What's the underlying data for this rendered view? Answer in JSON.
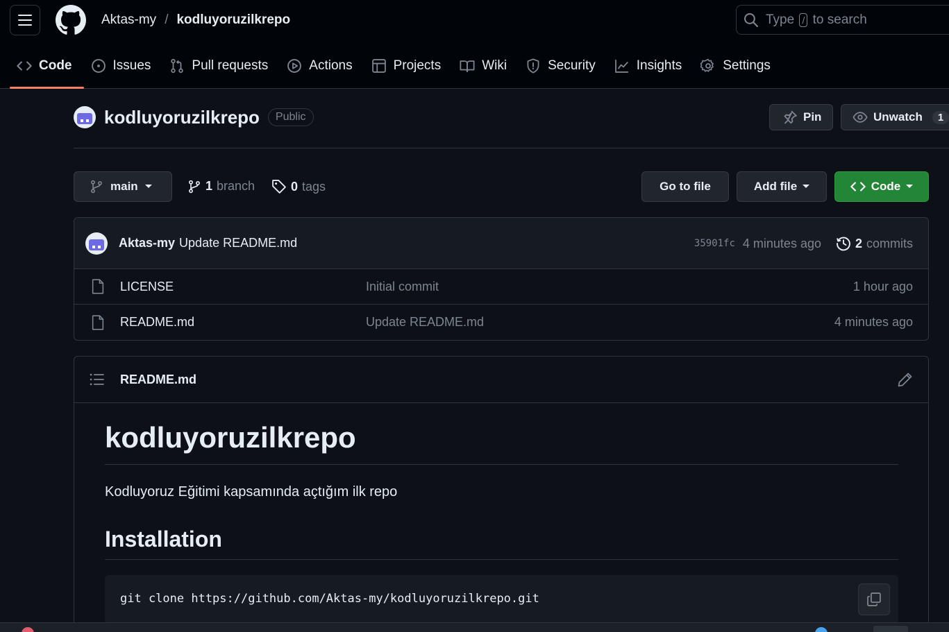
{
  "header": {
    "owner": "Aktas-my",
    "separator": "/",
    "repo": "kodluyoruzilkrepo",
    "search": {
      "before": "Type",
      "key": "/",
      "after": "to search"
    }
  },
  "tabs": [
    {
      "label": "Code",
      "icon": "code-icon",
      "active": true
    },
    {
      "label": "Issues",
      "icon": "issue-icon"
    },
    {
      "label": "Pull requests",
      "icon": "pull-request-icon"
    },
    {
      "label": "Actions",
      "icon": "play-icon"
    },
    {
      "label": "Projects",
      "icon": "table-icon"
    },
    {
      "label": "Wiki",
      "icon": "book-icon"
    },
    {
      "label": "Security",
      "icon": "shield-icon"
    },
    {
      "label": "Insights",
      "icon": "graph-icon"
    },
    {
      "label": "Settings",
      "icon": "gear-icon"
    }
  ],
  "repo_header": {
    "name": "kodluyoruzilkrepo",
    "visibility": "Public",
    "pin_label": "Pin",
    "watch_label": "Unwatch",
    "watch_count": "1"
  },
  "branch_bar": {
    "branch": "main",
    "branch_count": "1",
    "branch_word": "branch",
    "tag_count": "0",
    "tag_word": "tags",
    "goto_label": "Go to file",
    "add_label": "Add file",
    "code_label": "Code"
  },
  "latest_commit": {
    "author": "Aktas-my",
    "message": "Update README.md",
    "sha": "35901fc",
    "time": "4 minutes ago",
    "commit_count": "2",
    "commit_word": "commits"
  },
  "files": [
    {
      "name": "LICENSE",
      "commit": "Initial commit",
      "time": "1 hour ago"
    },
    {
      "name": "README.md",
      "commit": "Update README.md",
      "time": "4 minutes ago"
    }
  ],
  "readme": {
    "filename": "README.md",
    "h1": "kodluyoruzilkrepo",
    "paragraph": "Kodluyoruz Eğitimi kapsamında açtığım ilk repo",
    "h2": "Installation",
    "code": "git clone https://github.com/Aktas-my/kodluyoruzilkrepo.git"
  },
  "colors": {
    "background": "#0d1117",
    "header": "#010409",
    "accent_tab": "#f78166",
    "green_button": "#238636",
    "muted_text": "#7d8590",
    "border": "#30363d"
  }
}
